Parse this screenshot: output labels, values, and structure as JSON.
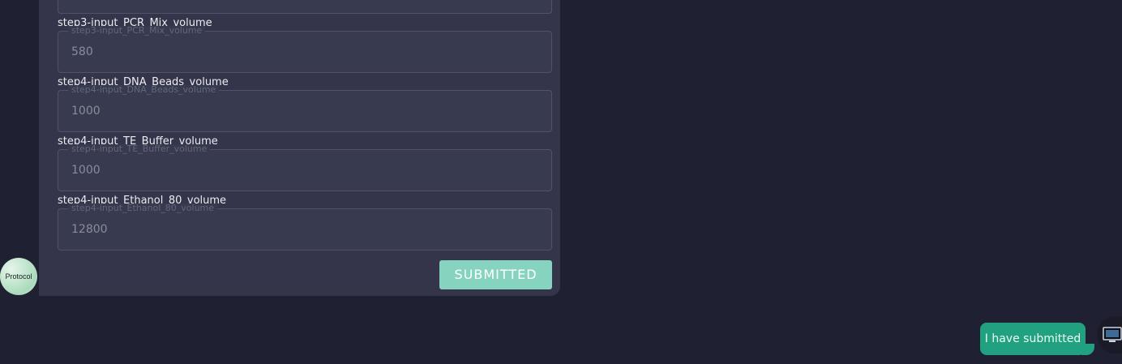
{
  "form": {
    "fields": [
      {
        "label": "step3-input_PCR_Mix_volume",
        "legend": "step3-input_PCR_Mix_volume",
        "value": "580"
      },
      {
        "label": "step4-input_DNA_Beads_volume",
        "legend": "step4-input_DNA_Beads_volume",
        "value": "1000"
      },
      {
        "label": "step4-input_TE_Buffer_volume",
        "legend": "step4-input_TE_Buffer_volume",
        "value": "1000"
      },
      {
        "label": "step4-input_Ethanol_80_volume",
        "legend": "step4-input_Ethanol_80_volume",
        "value": "12800"
      }
    ],
    "submit_label": "SUBMITTED"
  },
  "bot_avatar": {
    "label": "Protocol"
  },
  "user_message": {
    "text": "I have submitted"
  },
  "user_avatar": {
    "icon": "computer-icon"
  },
  "colors": {
    "background": "#1f2031",
    "card": "#34354a",
    "submit": "#86d4bf",
    "user_bubble": "#21a17f"
  }
}
